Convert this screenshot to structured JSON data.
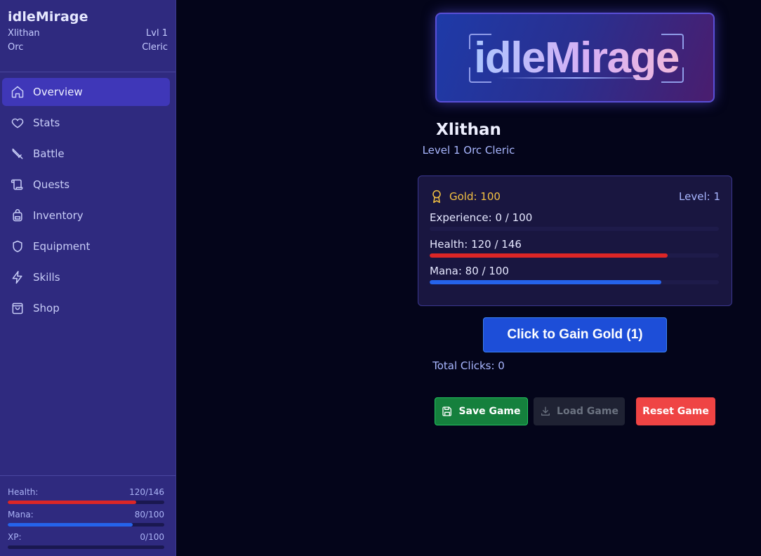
{
  "app_title": "idleMirage",
  "character": {
    "name": "Xlithan",
    "level_label": "Lvl 1",
    "race": "Orc",
    "class": "Cleric",
    "subtitle": "Level 1 Orc Cleric"
  },
  "nav": [
    {
      "label": "Overview",
      "icon": "home-icon",
      "active": true
    },
    {
      "label": "Stats",
      "icon": "heart-icon",
      "active": false
    },
    {
      "label": "Battle",
      "icon": "sword-icon",
      "active": false
    },
    {
      "label": "Quests",
      "icon": "scroll-icon",
      "active": false
    },
    {
      "label": "Inventory",
      "icon": "backpack-icon",
      "active": false
    },
    {
      "label": "Equipment",
      "icon": "shield-icon",
      "active": false
    },
    {
      "label": "Skills",
      "icon": "lightning-icon",
      "active": false
    },
    {
      "label": "Shop",
      "icon": "shopping-bag-icon",
      "active": false
    }
  ],
  "sidebar_stats": {
    "health": {
      "label": "Health:",
      "value": "120/146",
      "fraction": 0.822,
      "color": "#dc2626"
    },
    "mana": {
      "label": "Mana:",
      "value": "80/100",
      "fraction": 0.8,
      "color": "#2563eb"
    },
    "xp": {
      "label": "XP:",
      "value": "0/100",
      "fraction": 0,
      "color": "#7c3aed"
    }
  },
  "logo_text": "idleMirage",
  "stats_card": {
    "gold_label": "Gold: 100",
    "level_label": "Level: 1",
    "experience": {
      "label": "Experience: 0 / 100",
      "fraction": 0,
      "color": "#7c3aed"
    },
    "health": {
      "label": "Health: 120 / 146",
      "fraction": 0.822,
      "color": "#dc2626"
    },
    "mana": {
      "label": "Mana: 80 / 100",
      "fraction": 0.8,
      "color": "#2563eb"
    }
  },
  "gain_button_label": "Click to Gain Gold (1)",
  "total_clicks_label": "Total Clicks: 0",
  "actions": {
    "save_label": "Save Game",
    "load_label": "Load Game",
    "reset_label": "Reset Game"
  },
  "colors": {
    "sidebar_bg": "#2f2a7f",
    "active_nav": "#3f37b8",
    "gold": "#f5c242",
    "primary_button": "#1d4ed8",
    "save_button": "#15803d",
    "reset_button": "#ef4444"
  }
}
